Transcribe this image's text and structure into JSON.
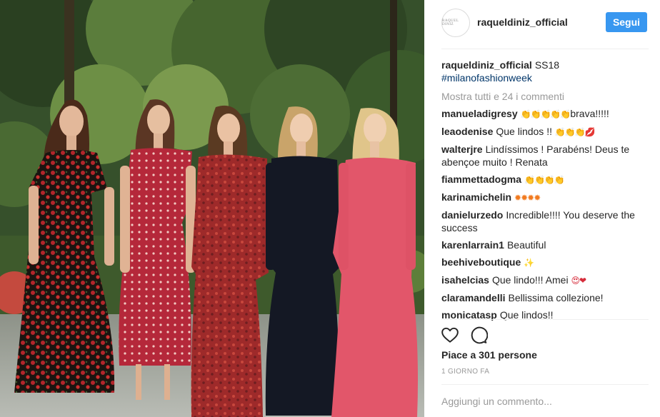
{
  "post": {
    "photo_alt": "",
    "author": "raqueldiniz_official",
    "avatar_text": "RAQUEL DINIZ",
    "follow_label": "Segui",
    "caption_text": "SS18",
    "caption_hashtag": "#milanofashionweek",
    "show_all_comments": "Mostra tutti e 24 i commenti",
    "comments": [
      {
        "user": "manueladigresy",
        "text": "",
        "emoji": "👏👏👏👏👏",
        "emoji_class": "yellow",
        "text_after": "brava!!!!!"
      },
      {
        "user": "leaodenise",
        "text": "Que lindos !!",
        "emoji": "👏👏👏💋",
        "emoji_class": "yellow",
        "text_after": ""
      },
      {
        "user": "walterjre",
        "text": "Lindíssimos ! Parabéns! Deus te abençoe muito ! Renata",
        "emoji": "",
        "emoji_class": "",
        "text_after": ""
      },
      {
        "user": "fiammettadogma",
        "text": "",
        "emoji": "👏👏👏👏",
        "emoji_class": "pale",
        "text_after": ""
      },
      {
        "user": "karinamichelin",
        "text": "",
        "emoji": "✹✹✹✹",
        "emoji_class": "orange",
        "text_after": ""
      },
      {
        "user": "danielurzedo",
        "text": "Incredible!!!! You deserve the success",
        "emoji": "",
        "emoji_class": "",
        "text_after": ""
      },
      {
        "user": "karenlarrain1",
        "text": "Beautiful",
        "emoji": "",
        "emoji_class": "",
        "text_after": ""
      },
      {
        "user": "beehiveboutique",
        "text": "",
        "emoji": "✨",
        "emoji_class": "yellow",
        "text_after": ""
      },
      {
        "user": "isahelcias",
        "text": "Que lindo!!! Amei",
        "emoji": "😍❤",
        "emoji_class": "red",
        "text_after": ""
      },
      {
        "user": "claramandelli",
        "text": "Bellissima collezione!",
        "emoji": "",
        "emoji_class": "",
        "text_after": ""
      },
      {
        "user": "monicatasp",
        "text": "Que lindos!!",
        "emoji": "",
        "emoji_class": "",
        "text_after": ""
      }
    ],
    "likes": "Piace a 301 persone",
    "timestamp": "1 GIORNO FA",
    "add_comment_placeholder": "Aggiungi un commento..."
  },
  "icons": {
    "like": "heart-icon",
    "comment": "comment-icon"
  },
  "colors": {
    "follow_button": "#3897f0",
    "hashtag": "#003569",
    "muted": "#999999"
  }
}
